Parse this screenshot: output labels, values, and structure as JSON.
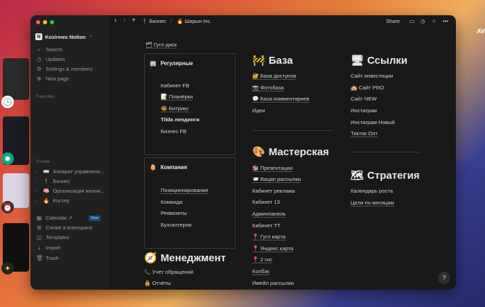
{
  "desktop": {
    "edge_text": "AV"
  },
  "window": {
    "workspace": "Kozirews Notion",
    "sidebar": {
      "top_items": [
        {
          "label": "Search",
          "icon": "search-icon"
        },
        {
          "label": "Updates",
          "icon": "clock-icon"
        },
        {
          "label": "Settings & members",
          "icon": "gear-icon"
        },
        {
          "label": "New page",
          "icon": "plus-icon"
        }
      ],
      "favorites_label": "Favorites",
      "private_label": "Private",
      "private_items": [
        {
          "emoji": "⌨️",
          "label": "Аппарат управлени..."
        },
        {
          "emoji": "🕴",
          "label": "Бизнес"
        },
        {
          "emoji": "🧠",
          "label": "Организация жизни..."
        },
        {
          "emoji": "🔥",
          "label": "Костер"
        }
      ],
      "bottom_items": [
        {
          "label": "Calendar ↗",
          "icon": "calendar-icon",
          "badge": "New"
        },
        {
          "label": "Create a teamspace",
          "icon": "team-icon"
        },
        {
          "label": "Templates",
          "icon": "templates-icon"
        },
        {
          "label": "Import",
          "icon": "import-icon"
        },
        {
          "label": "Trash",
          "icon": "trash-icon"
        }
      ]
    },
    "topbar": {
      "breadcrumb": [
        {
          "emoji": "🕴",
          "label": "Бизнес"
        },
        {
          "emoji": "🔥",
          "label": "Шарын Inc."
        }
      ],
      "separator": "/",
      "share": "Share"
    },
    "content": {
      "top_link": "Гугл-диск",
      "regular": {
        "title": "Регулярные",
        "items": [
          "Кабинет FB",
          "📝 Планёрки",
          "🐝 Битрикс",
          "Tilda лендинги",
          "Бизнес FB"
        ]
      },
      "company": {
        "title": "Компания",
        "items": [
          "Позиционирование",
          "Команда",
          "Реквизиты",
          "Бухгалтерия"
        ]
      },
      "management": {
        "title": "Менеджмент",
        "items": [
          "📞 Учёт обращений",
          "🔒 Отчёты"
        ]
      },
      "base": {
        "title": "База",
        "items": [
          "🔐 База доступов",
          "📸 Фотобаза",
          "💬 База комментариев",
          "Идеи"
        ]
      },
      "workshop": {
        "title": "Мастерская",
        "items": [
          "📚 Презентации",
          "📨 Вацап рассылки",
          "Кабинет реклама",
          "Кабинет 13",
          "Админпанель",
          "Кабинет ТТ",
          "📍 Гугл карта",
          "📍 Яндекс карта",
          "📍 2 гис",
          "Колбэк",
          "Имейл рассылки"
        ]
      },
      "links": {
        "title": "Ссылки",
        "items": [
          "Сайт инвестиции",
          "🏫 Сайт PRO",
          "Сайт NEW",
          "Инстаграм",
          "Инстаграм Новый",
          "Тикток Опт"
        ]
      },
      "strategy": {
        "title": "Стратегия",
        "items": [
          "Календарь роста",
          "Цели по месяцам"
        ]
      },
      "help": "?"
    }
  }
}
